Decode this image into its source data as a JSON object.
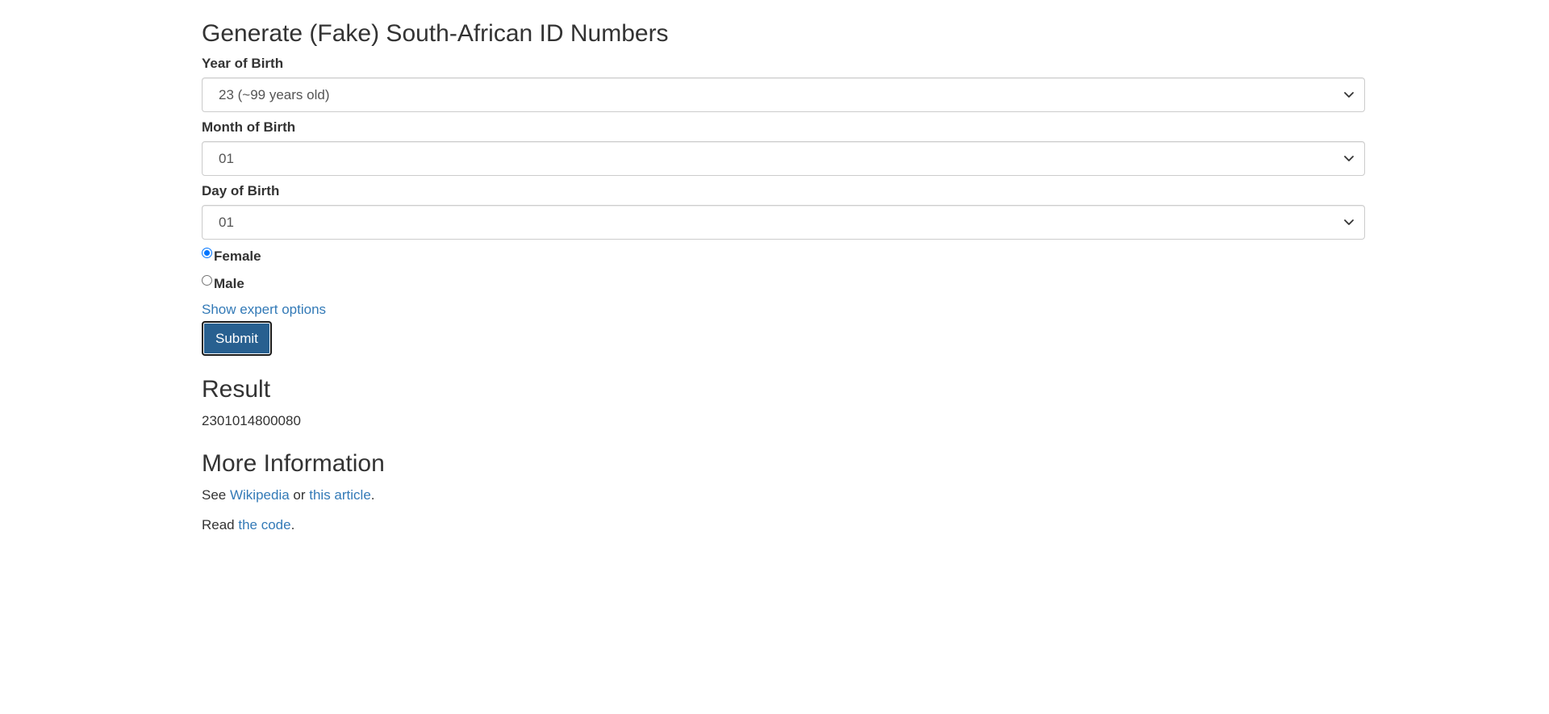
{
  "page": {
    "title": "Generate (Fake) South-African ID Numbers"
  },
  "form": {
    "year": {
      "label": "Year of Birth",
      "selected": "23 (~99 years old)"
    },
    "month": {
      "label": "Month of Birth",
      "selected": "01"
    },
    "day": {
      "label": "Day of Birth",
      "selected": "01"
    },
    "gender": {
      "options": [
        {
          "label": "Female",
          "checked": true
        },
        {
          "label": "Male",
          "checked": false
        }
      ]
    },
    "expert_link": "Show expert options",
    "submit_label": "Submit"
  },
  "result": {
    "heading": "Result",
    "value": "2301014800080"
  },
  "info": {
    "heading": "More Information",
    "line1": {
      "prefix": "See ",
      "link1": "Wikipedia",
      "middle": " or ",
      "link2": "this article",
      "suffix": "."
    },
    "line2": {
      "prefix": "Read ",
      "link": "the code",
      "suffix": "."
    }
  },
  "icons": {
    "dropdown": "chevron-down-icon"
  },
  "colors": {
    "link": "#337ab7",
    "button_bg": "#286090",
    "radio_checked": "#0075ff",
    "text": "#333333"
  }
}
